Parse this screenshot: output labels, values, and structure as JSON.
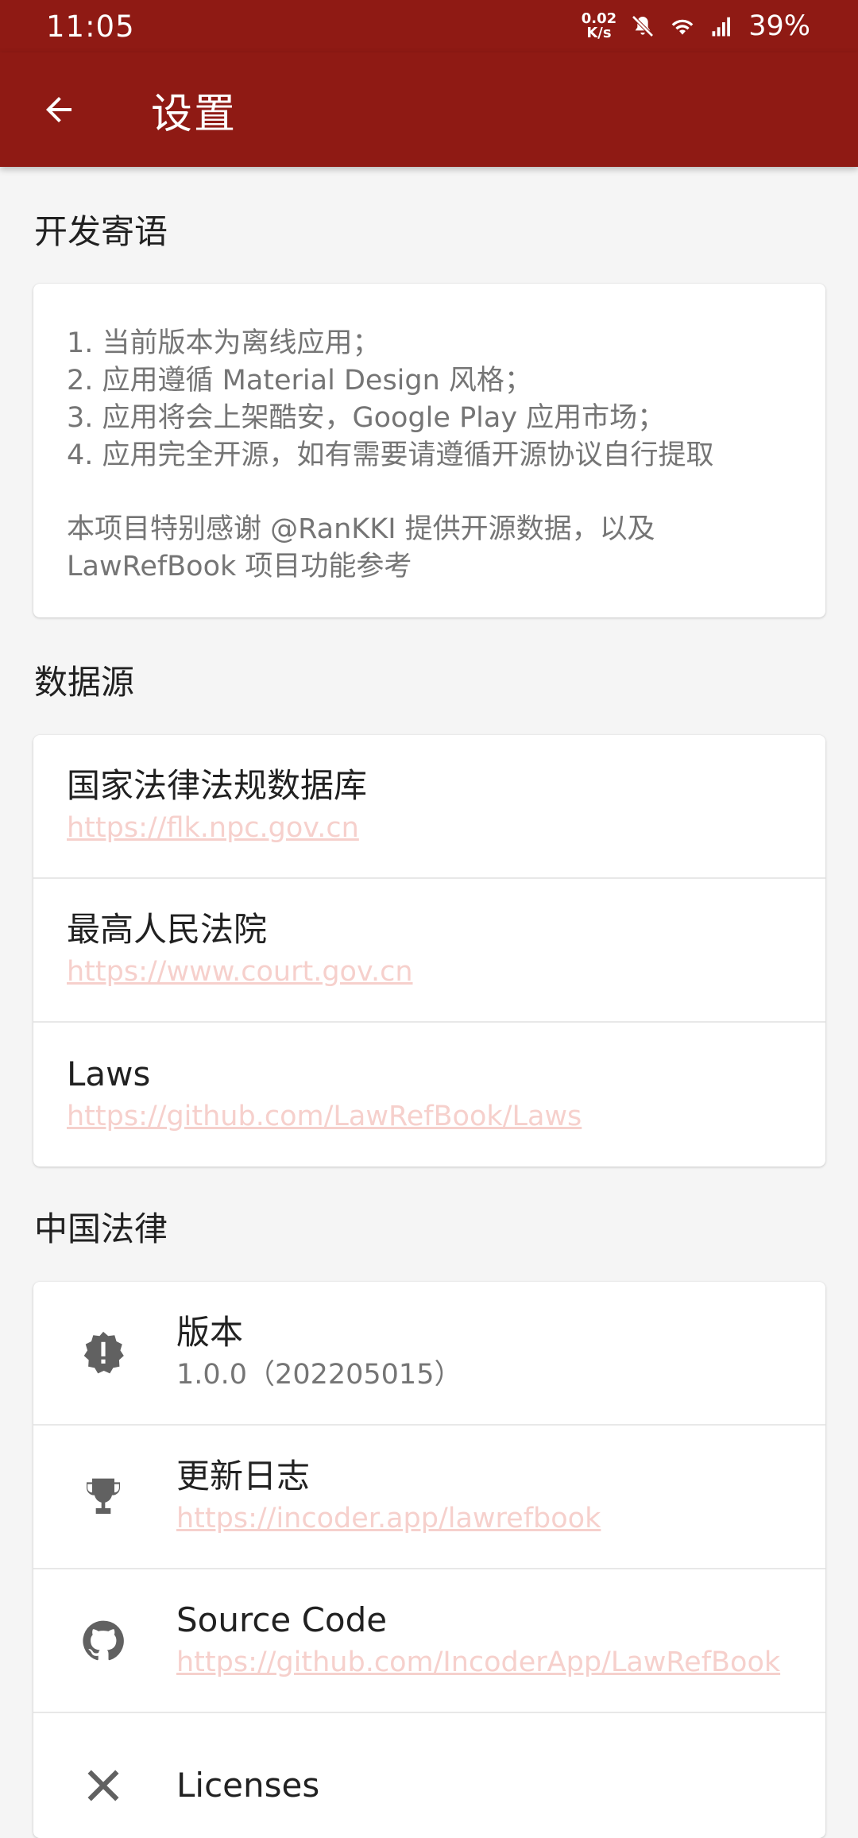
{
  "status_bar": {
    "time": "11:05",
    "net_speed_value": "0.02",
    "net_speed_unit": "K/s",
    "battery": "39%"
  },
  "app_bar": {
    "title": "设置",
    "back_icon": "arrow-left-icon"
  },
  "colors": {
    "primary": "#8f1a14",
    "link": "#f6d0cc",
    "text_primary": "#212121",
    "text_secondary": "#757575"
  },
  "sections": {
    "dev_notes": {
      "title": "开发寄语",
      "lines": [
        "1. 当前版本为离线应用；",
        "2. 应用遵循 Material Design 风格；",
        "3. 应用将会上架酷安，Google Play 应用市场；",
        "4. 应用完全开源，如有需要请遵循开源协议自行提取"
      ],
      "thanks": [
        "本项目特别感谢 @RanKKI 提供开源数据，以及",
        "LawRefBook 项目功能参考"
      ]
    },
    "data_sources": {
      "title": "数据源",
      "items": [
        {
          "title": "国家法律法规数据库",
          "link": "https://flk.npc.gov.cn"
        },
        {
          "title": "最高人民法院",
          "link": "https://www.court.gov.cn"
        },
        {
          "title": "Laws",
          "link": "https://github.com/LawRefBook/Laws"
        }
      ]
    },
    "about": {
      "title": "中国法律",
      "items": [
        {
          "icon": "badge-alert-icon",
          "title": "版本",
          "value": "1.0.0（202205015）"
        },
        {
          "icon": "trophy-icon",
          "title": "更新日志",
          "link": "https://incoder.app/lawrefbook"
        },
        {
          "icon": "github-icon",
          "title": "Source Code",
          "link": "https://github.com/IncoderApp/LawRefBook"
        },
        {
          "icon": "licenses-icon",
          "title": "Licenses"
        }
      ]
    }
  }
}
